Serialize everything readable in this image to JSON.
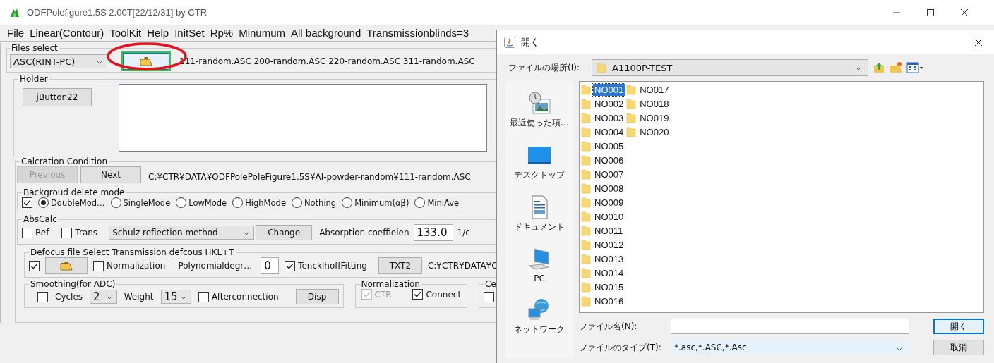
{
  "window": {
    "title": "ODFPolefigure1.5S 2.00T[22/12/31] by CTR"
  },
  "menu": [
    "File",
    "Linear(Contour)",
    "ToolKit",
    "Help",
    "InitSet",
    "Rp%",
    "Minumum",
    "All background",
    "Transmissionblinds=3"
  ],
  "files_select": {
    "title": "Files select",
    "format": "ASC(RINT-PC)",
    "open_highlighted": true,
    "files": "111-random.ASC 200-random.ASC 220-random.ASC 311-random.ASC"
  },
  "holder": {
    "title": "Holder",
    "button": "jButton22"
  },
  "calc": {
    "title": "Calcration Condition",
    "buttons": [
      {
        "label": "Previous",
        "disabled": true
      },
      {
        "label": "Next",
        "disabled": false
      }
    ],
    "path": "C:¥CTR¥DATA¥ODFPolePoleFigure1.5S¥Al-powder-random¥111-random.ASC"
  },
  "background": {
    "title": "Backgroud delete mode",
    "checked": true,
    "modes": [
      {
        "label": "DoubleMod…",
        "selected": true
      },
      {
        "label": "SingleMode",
        "selected": false
      },
      {
        "label": "LowMode",
        "selected": false
      },
      {
        "label": "HighMode",
        "selected": false
      },
      {
        "label": "Nothing",
        "selected": false
      },
      {
        "label": "Minimum(αβ)",
        "selected": false
      },
      {
        "label": "MiniAve",
        "selected": false
      }
    ]
  },
  "abscalc": {
    "title": "AbsCalc",
    "options": [
      {
        "label": "Ref",
        "checked": false
      },
      {
        "label": "Trans",
        "checked": false
      }
    ],
    "method": "Schulz reflection method",
    "change": "Change",
    "coef_label": "Absorption coeffieien",
    "coef": "133.0",
    "unit": "1/c"
  },
  "defocus": {
    "title": "Defocus file Select Transmission defcous HKL+T",
    "checked": true,
    "normalization": {
      "label": "Normalization",
      "checked": false
    },
    "poly_label": "Polynomialdegr…",
    "poly": "0",
    "fitting": {
      "label": "TencklhoffFitting",
      "checked": true
    },
    "txt_button": "TXT2",
    "path": "C:¥CTR¥DATA¥O"
  },
  "smoothing": {
    "title": "Smoothing(for ADC)",
    "checked": false,
    "cycles_label": "Cycles",
    "cycles": "2",
    "weight_label": "Weight",
    "weight": "15",
    "after": {
      "label": "Afterconnection",
      "checked": false
    },
    "button": "Disp"
  },
  "normalization": {
    "title": "Normalization",
    "options": [
      {
        "label": "CTR",
        "checked": true,
        "disabled": true
      },
      {
        "label": "Connect",
        "checked": true,
        "disabled": false
      }
    ]
  },
  "cut_group": {
    "title": "Ce",
    "checked": false
  },
  "dialog": {
    "title": "開く",
    "location_label": "ファイルの場所(I):",
    "location": "A1100P-TEST",
    "places": [
      {
        "label": "最近使った項…",
        "kind": "recent"
      },
      {
        "label": "デスクトップ",
        "kind": "desktop"
      },
      {
        "label": "ドキュメント",
        "kind": "documents"
      },
      {
        "label": "PC",
        "kind": "pc"
      },
      {
        "label": "ネットワーク",
        "kind": "network"
      }
    ],
    "files": [
      {
        "name": "NO001",
        "selected": true
      },
      {
        "name": "NO002",
        "selected": false
      },
      {
        "name": "NO003",
        "selected": false
      },
      {
        "name": "NO004",
        "selected": false
      },
      {
        "name": "NO005",
        "selected": false
      },
      {
        "name": "NO006",
        "selected": false
      },
      {
        "name": "NO007",
        "selected": false
      },
      {
        "name": "NO008",
        "selected": false
      },
      {
        "name": "NO009",
        "selected": false
      },
      {
        "name": "NO010",
        "selected": false
      },
      {
        "name": "NO011",
        "selected": false
      },
      {
        "name": "NO012",
        "selected": false
      },
      {
        "name": "NO013",
        "selected": false
      },
      {
        "name": "NO014",
        "selected": false
      },
      {
        "name": "NO015",
        "selected": false
      },
      {
        "name": "NO016",
        "selected": false
      },
      {
        "name": "NO017",
        "selected": false
      },
      {
        "name": "NO018",
        "selected": false
      },
      {
        "name": "NO019",
        "selected": false
      },
      {
        "name": "NO020",
        "selected": false
      }
    ],
    "filename_label": "ファイル名(N):",
    "type_label": "ファイルのタイプ(T):",
    "type": "*.asc,*.ASC,*.Asc",
    "buttons": [
      {
        "label": "開く",
        "default": true
      },
      {
        "label": "取消",
        "default": false
      }
    ]
  }
}
